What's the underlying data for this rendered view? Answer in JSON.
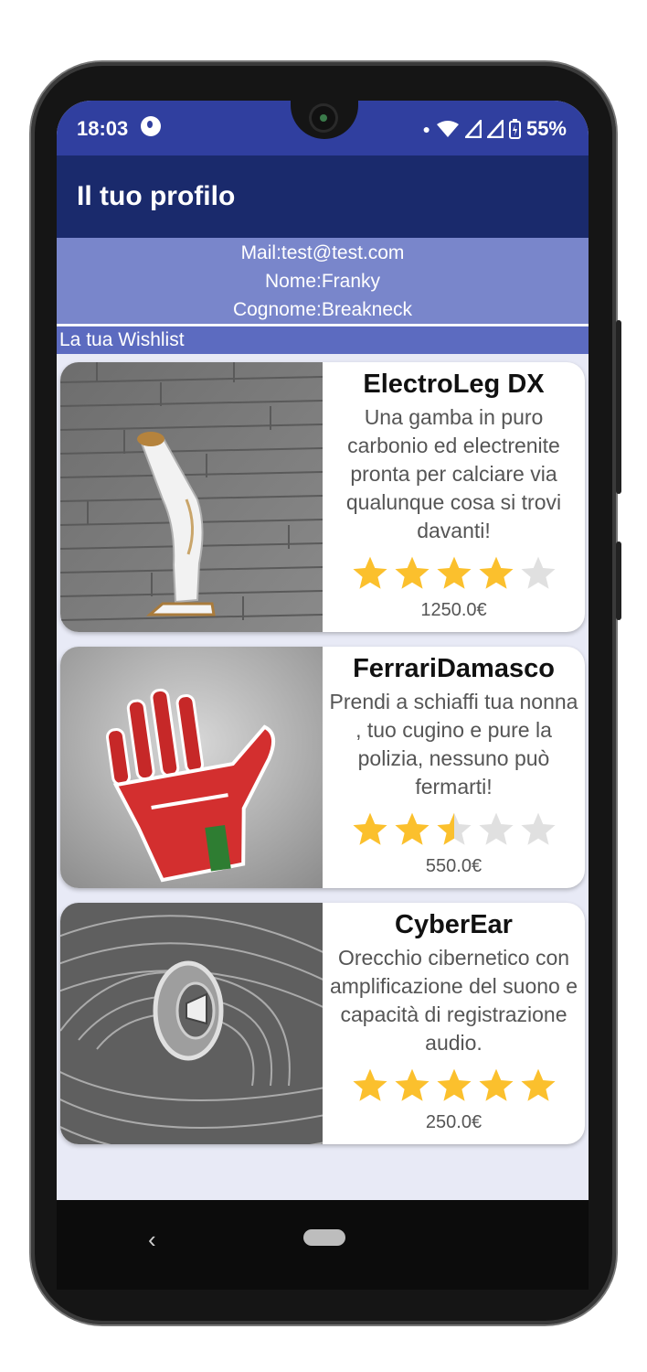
{
  "status_bar": {
    "time": "18:03",
    "battery": "55%"
  },
  "app_bar": {
    "title": "Il tuo profilo"
  },
  "profile": {
    "mail": "Mail:test@test.com",
    "nome": "Nome:Franky",
    "cognome": "Cognome:Breakneck"
  },
  "wishlist": {
    "header": "La tua Wishlist",
    "items": [
      {
        "name": "ElectroLeg DX",
        "description": "Una gamba in puro carbonio ed electrenite pronta per calciare via qualunque cosa si trovi davanti!",
        "rating": 4,
        "max_rating": 5,
        "price": "1250.0€",
        "image": "robotic-leg-image"
      },
      {
        "name": "FerrariDamasco",
        "description": "Prendi a schiaffi tua nonna , tuo cugino e pure la polizia, nessuno può fermarti!",
        "rating": 2.5,
        "max_rating": 5,
        "price": "550.0€",
        "image": "robotic-hand-image"
      },
      {
        "name": "CyberEar",
        "description": "Orecchio cibernetico con amplificazione del suono e capacità di registrazione audio.",
        "rating": 5,
        "max_rating": 5,
        "price": "250.0€",
        "image": "cyber-ear-image"
      }
    ]
  },
  "colors": {
    "status_bar": "#303f9f",
    "app_bar": "#1a2a6c",
    "profile_bg": "#7986cb",
    "wishlist_header_bg": "#5c6bc0",
    "star_filled": "#fbc02d",
    "star_empty": "#e0e0e0"
  },
  "navigation": {
    "back_icon": "back-chevron-icon",
    "home_icon": "home-pill-icon"
  }
}
